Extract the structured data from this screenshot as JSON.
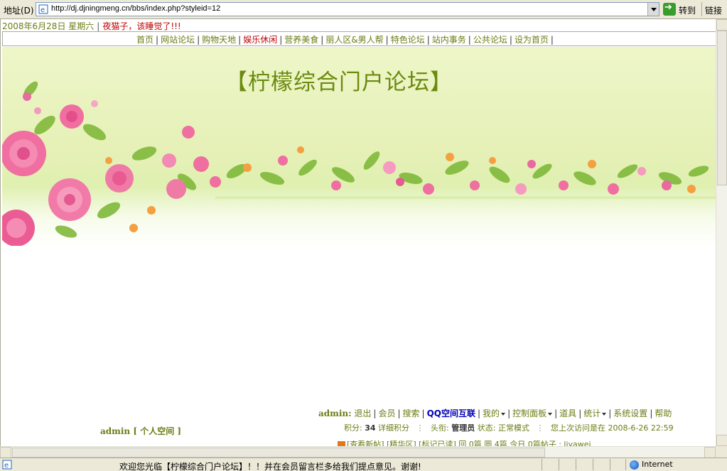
{
  "browser": {
    "address_label": "地址(D)",
    "url": "http://dj.djningmeng.cn/bbs/index.php?styleid=12",
    "go_label": "转到",
    "links_label": "链接",
    "status_text": "欢迎您光临【柠檬综合门户论坛】！！并在会员留言栏多给我们提点意见。谢谢!",
    "zone_label": "Internet"
  },
  "topinfo": {
    "date": "2008年6月28日 星期六",
    "message": "夜猫子，该睡觉了!!!"
  },
  "nav": [
    {
      "label": "首页",
      "hot": false
    },
    {
      "label": "网站论坛",
      "hot": false
    },
    {
      "label": "购物天地",
      "hot": false
    },
    {
      "label": "娱乐休闲",
      "hot": true
    },
    {
      "label": "营养美食",
      "hot": false
    },
    {
      "label": "丽人区&男人帮",
      "hot": false
    },
    {
      "label": "特色论坛",
      "hot": false
    },
    {
      "label": "站内事务",
      "hot": false
    },
    {
      "label": "公共论坛",
      "hot": false
    },
    {
      "label": "设为首页",
      "hot": false
    }
  ],
  "banner": {
    "title": "【柠檬综合门户论坛】"
  },
  "user": {
    "name": "admin",
    "name_colon": "admin:",
    "personal_space": "[ 个人空间 ]",
    "links": {
      "logout": "退出",
      "members": "会员",
      "search": "搜索",
      "qq": "QQ空间互联",
      "mine": "我的",
      "control_panel": "控制面板",
      "tools": "道具",
      "stats": "统计",
      "settings": "系统设置",
      "help": "帮助"
    },
    "points_label": "积分:",
    "points_value": "34",
    "points_detail": "详细积分",
    "rank_label": "头衔:",
    "rank_value": "管理员",
    "status_label": "状态:",
    "status_value": "正常模式",
    "last_visit_label": "您上次访问是在",
    "last_visit_value": "2008-6-26 22:59",
    "row3_text": "[查看新帖] [精华区] [标记已读]  回 0篇  圆 4篇 今日 0篇帖子  :  liyawei"
  }
}
